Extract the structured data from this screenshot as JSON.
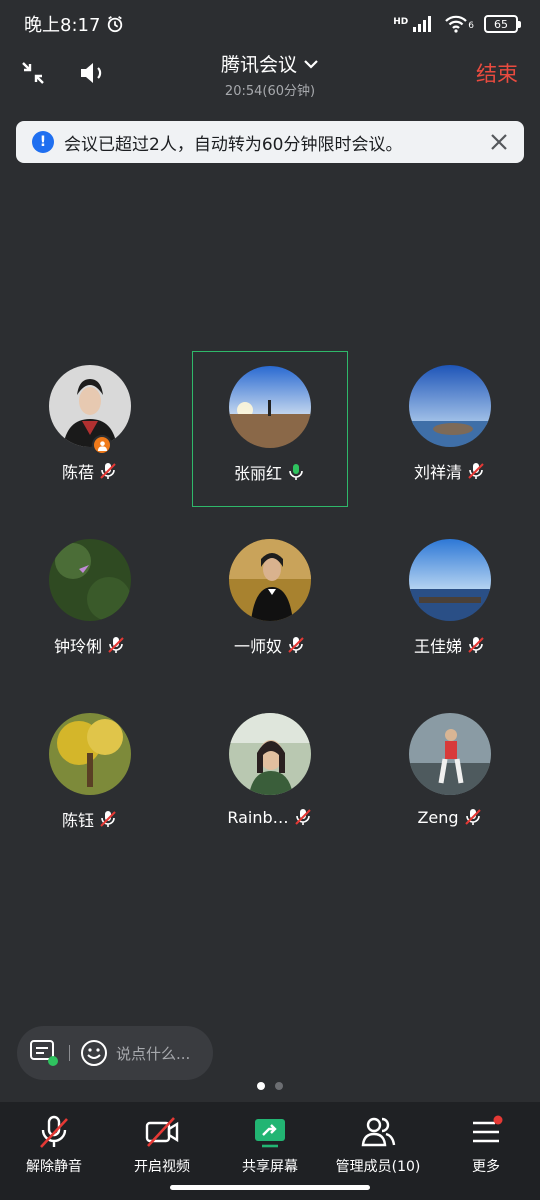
{
  "status_bar": {
    "time": "晚上8:17",
    "battery": "65",
    "network_badge": "HD",
    "wifi_badge": "6"
  },
  "header": {
    "title": "腾讯会议",
    "subtitle": "20:54(60分钟)",
    "end_label": "结束"
  },
  "notice": {
    "text": "会议已超过2人，自动转为60分钟限时会议。"
  },
  "participants": [
    {
      "name": "陈蓓",
      "muted": true,
      "host": true
    },
    {
      "name": "张丽红",
      "muted": false,
      "active": true
    },
    {
      "name": "刘祥清",
      "muted": true
    },
    {
      "name": "钟玲俐",
      "muted": true
    },
    {
      "name": "一师奴",
      "muted": true
    },
    {
      "name": "王佳娣",
      "muted": true
    },
    {
      "name": "陈钰",
      "muted": true
    },
    {
      "name": "Rainb…",
      "muted": true
    },
    {
      "name": "Zeng",
      "muted": true
    }
  ],
  "chat": {
    "placeholder": "说点什么..."
  },
  "pager": {
    "pages": 2,
    "current": 1
  },
  "toolbar": {
    "unmute": "解除静音",
    "video": "开启视频",
    "share": "共享屏幕",
    "members": "管理成员(10)",
    "more": "更多"
  },
  "colors": {
    "end": "#ea4b3f",
    "active_border": "#2fb86a",
    "notice_icon": "#1f6ff0",
    "share_icon": "#22b573"
  }
}
